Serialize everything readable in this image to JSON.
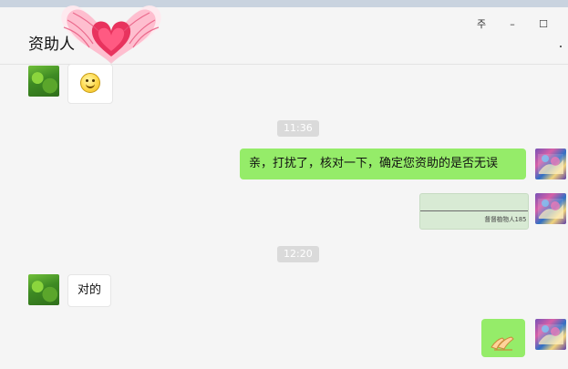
{
  "window": {
    "title": "资助人"
  },
  "controls": {
    "pin": "주",
    "minimize": "–",
    "maximize": "☐"
  },
  "messages": [
    {
      "type": "emoji",
      "side": "left",
      "icon": "smiley-face"
    },
    {
      "type": "time",
      "text": "11:36"
    },
    {
      "type": "text",
      "side": "right",
      "text": "亲，打扰了，核对一下，确定您资助的是否无误"
    },
    {
      "type": "image",
      "side": "right",
      "caption": "督督植物人185"
    },
    {
      "type": "time",
      "text": "12:20"
    },
    {
      "type": "text",
      "side": "left",
      "text": "对的"
    },
    {
      "type": "emoji",
      "side": "right",
      "icon": "hands-together"
    }
  ],
  "colors": {
    "background": "#f5f5f5",
    "right_bubble": "#95ec69",
    "left_bubble": "#ffffff",
    "time_badge": "#dadada"
  }
}
